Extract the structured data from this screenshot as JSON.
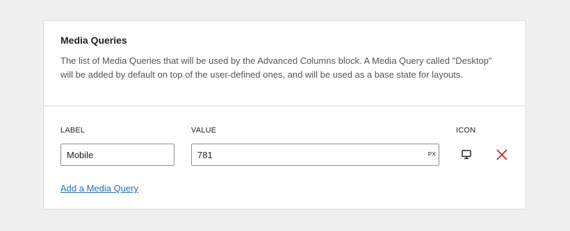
{
  "section": {
    "title": "Media Queries",
    "description": "The list of Media Queries that will be used by the Advanced Columns block. A Media Query called \"Desktop\" will be added by default on top of the user-defined ones, and will be used as a base state for layouts."
  },
  "columns": {
    "label": "LABEL",
    "value": "VALUE",
    "icon": "ICON"
  },
  "rows": [
    {
      "label": "Mobile",
      "value": "781",
      "unit": "PX",
      "icon": "desktop-monitor-icon",
      "remove_icon": "close-icon"
    }
  ],
  "add_link": "Add a Media Query",
  "colors": {
    "remove": "#cc1818",
    "link": "#2271b1"
  }
}
